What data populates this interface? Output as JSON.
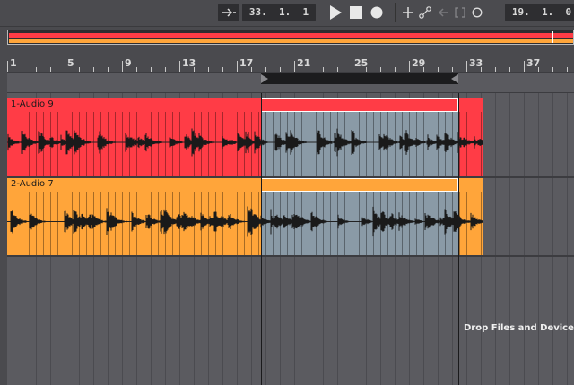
{
  "transport": {
    "arrangement_position": "33.  1.  1",
    "loop_length": "19.  1.  0"
  },
  "ruler": {
    "bars": [
      "1",
      "5",
      "9",
      "13",
      "17",
      "21",
      "25",
      "29",
      "33",
      "37"
    ]
  },
  "tracks": [
    {
      "clip_name": "1-Audio 9",
      "color": "#ff3c46"
    },
    {
      "clip_name": "2-Audio 7",
      "color": "#ffa53a"
    }
  ],
  "selection_color": "#8a9aa6",
  "drop_hint": "Drop Files and Devices He",
  "icons": {
    "follow": "follow-arrow-icon",
    "play": "play-icon",
    "stop": "stop-icon",
    "record": "record-icon",
    "overdub": "plus-icon",
    "automation": "automation-arm-icon",
    "back": "back-arrow-icon",
    "loop": "loop-bracket-icon",
    "punch": "circle-icon"
  }
}
